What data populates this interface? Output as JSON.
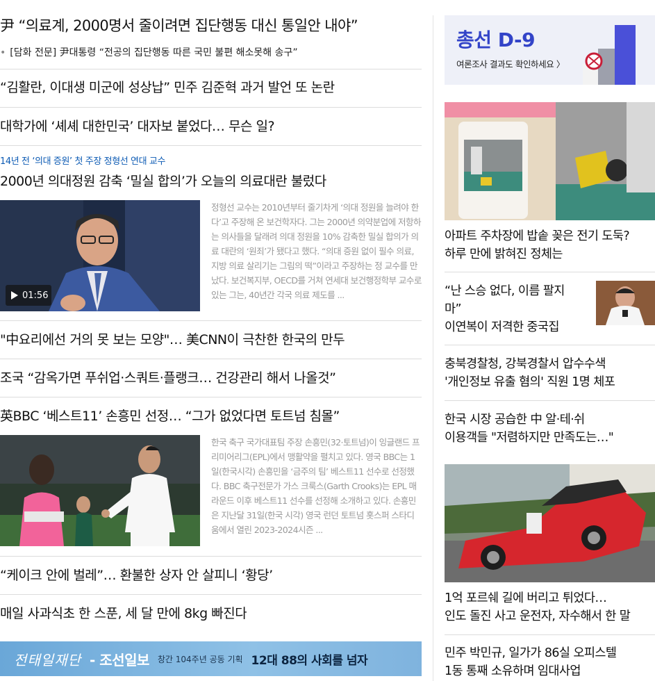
{
  "left": {
    "headlines": [
      "尹 “의료계, 2000명서 줄이려면 집단행동 대신 통일안 내야”",
      "“김활란, 이대생 미군에 성상납” 민주 김준혁 과거 발언 또 논란",
      "대학가에 ‘셰셰 대한민국’ 대자보 붙었다… 무슨 일?",
      "2000년 의대정원 감축 ‘밀실 합의’가 오늘의 의료대란 불렀다",
      "\"中요리에선 거의 못 보는 모양\"… 美CNN이 극찬한 한국의 만두",
      "조국 “감옥가면 푸쉬업·스쿼트·플랭크… 건강관리 해서 나올것”",
      "英BBC ‘베스트11’ 손흥민 선정… “그가 없었다면 토트넘 침몰”",
      "“케이크 안에 벌레”… 환불한 상자 안 살피니 ‘황당’",
      "매일 사과식초 한 스푼, 세 달 만에 8kg 빠진다"
    ],
    "sub_item": "[담화 전문] 尹대통령 “전공의 집단행동 따른 국민 불편 해소못해 송구”",
    "kicker": "14년 전 ‘의대 증원’ 첫 주장 정형선 연대 교수",
    "summary1": "정형선 교수는 2010년부터 줄기차게 ‘의대 정원을 늘려야 한다’고 주장해 온 보건학자다. 그는 2000년 의약분업에 저항하는 의사들을 달래려 의대 정원을 10% 감축한 밀실 합의가 의료 대란의 ‘원죄’가 됐다고 했다. “의대 증원 없이 필수 의료, 지방 의료 살리기는 그림의 떡”이라고 주장하는 정 교수를 만났다. 보건복지부, OECD를 거쳐 연세대 보건행정학부 교수로 있는 그는, 40년간 각국 의료 제도를 ...",
    "video_duration": "01:56",
    "summary2": "한국 축구 국가대표팀 주장 손흥민(32·토트넘)이 잉글랜드 프리미어리그(EPL)에서 맹활약을 펼치고 있다. 영국 BBC는 1일(한국시각) 손흥민을 ‘금주의 팀’ 베스트11 선수로 선정했다. BBC 축구전문가 가스 크룩스(Garth Crooks)는 EPL 매 라운드 이후 베스트11 선수를 선정해 소개하고 있다. 손흥민은 지난달 31일(한국 시각) 영국 런던 토트넘 홋스퍼 스타디움에서 열린 2023-2024시즌 ...",
    "banner": {
      "part1": "전태일재단",
      "part2": "- 조선일보",
      "part3": "창간 104주년 공동 기획",
      "part4": "12대 88의 사회를 넘자"
    }
  },
  "right": {
    "ad_title": "총선 D-9",
    "ad_sub": "여론조사 결과도 확인하세요 〉",
    "headlines": [
      [
        "아파트 주차장에 밥솥 꽂은 전기 도둑?",
        "하루 만에 밝혀진 정체는"
      ],
      [
        "“난 스승 없다, 이름 팔지",
        "마”",
        "이연복이 저격한 중국집"
      ],
      [
        "충북경찰청, 강북경찰서 압수수색",
        "'개인정보 유출 혐의' 직원 1명 체포"
      ],
      [
        "한국 시장 공습한 中 알·테·쉬",
        "이용객들 \"저렴하지만 만족도는…\""
      ],
      [
        "1억 포르쉐 길에 버리고 튀었다…",
        "인도 돌진 사고 운전자, 자수해서 한 말"
      ],
      [
        "민주 박민규, 일가가 86실 오피스텔",
        "1동 통째 소유하며 임대사업"
      ]
    ]
  }
}
